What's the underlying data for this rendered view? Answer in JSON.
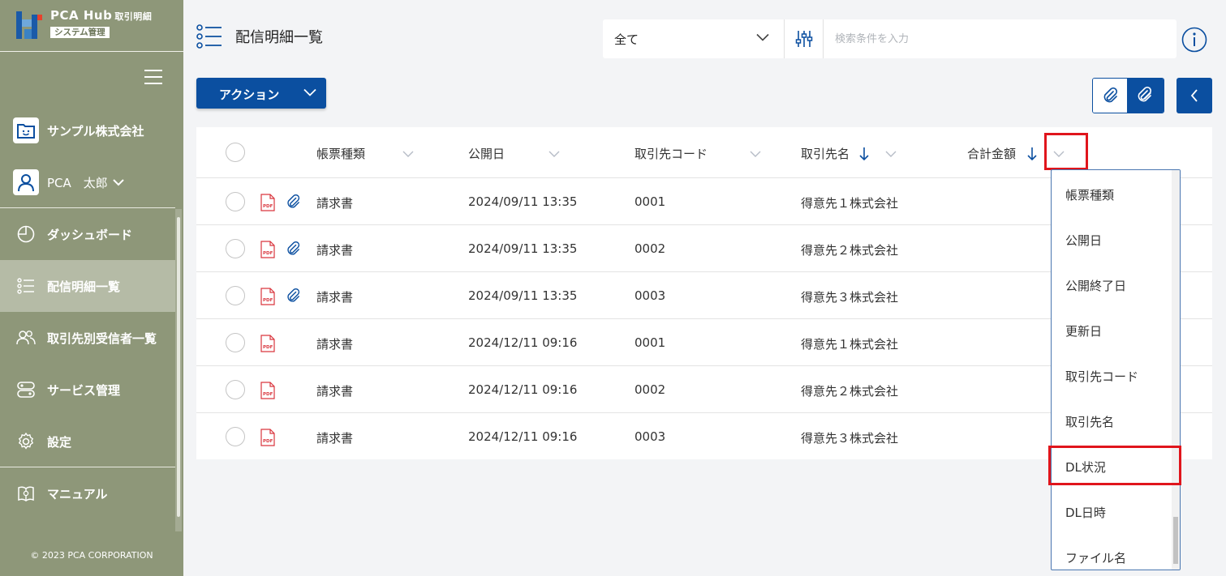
{
  "app": {
    "logo_title": "PCA Hub",
    "logo_sub": "取引明細",
    "logo_badge": "システム管理",
    "copyright": "© 2023 PCA CORPORATION"
  },
  "sidebar": {
    "company": "サンプル株式会社",
    "user": "PCA　太郎",
    "items": [
      {
        "label": "ダッシュボード",
        "icon": "dashboard-icon"
      },
      {
        "label": "配信明細一覧",
        "icon": "list-icon",
        "active": true
      },
      {
        "label": "取引先別受信者一覧",
        "icon": "users-icon"
      },
      {
        "label": "サービス管理",
        "icon": "service-icon"
      },
      {
        "label": "設定",
        "icon": "gear-icon"
      },
      {
        "label": "マニュアル",
        "icon": "manual-icon"
      }
    ]
  },
  "header": {
    "title": "配信明細一覧",
    "filter_selected": "全て",
    "search_placeholder": "検索条件を入力"
  },
  "toolbar": {
    "action_label": "アクション"
  },
  "table": {
    "columns": [
      "帳票種類",
      "公開日",
      "取引先コード",
      "取引先名",
      "合計金額"
    ],
    "rows": [
      {
        "type": "請求書",
        "date": "2024/09/11 13:35",
        "code": "0001",
        "name": "得意先１株式会社",
        "attachment": true
      },
      {
        "type": "請求書",
        "date": "2024/09/11 13:35",
        "code": "0002",
        "name": "得意先２株式会社",
        "attachment": true
      },
      {
        "type": "請求書",
        "date": "2024/09/11 13:35",
        "code": "0003",
        "name": "得意先３株式会社",
        "attachment": true
      },
      {
        "type": "請求書",
        "date": "2024/12/11 09:16",
        "code": "0001",
        "name": "得意先１株式会社",
        "attachment": false
      },
      {
        "type": "請求書",
        "date": "2024/12/11 09:16",
        "code": "0002",
        "name": "得意先２株式会社",
        "attachment": false
      },
      {
        "type": "請求書",
        "date": "2024/12/11 09:16",
        "code": "0003",
        "name": "得意先３株式会社",
        "attachment": false
      }
    ]
  },
  "dropdown": {
    "items": [
      "帳票種類",
      "公開日",
      "公開終了日",
      "更新日",
      "取引先コード",
      "取引先名",
      "DL状況",
      "DL日時",
      "ファイル名"
    ],
    "highlighted": "DL状況"
  },
  "colors": {
    "sidebar": "#8e9779",
    "primary": "#0b4fa0",
    "highlight": "#e0151c"
  }
}
